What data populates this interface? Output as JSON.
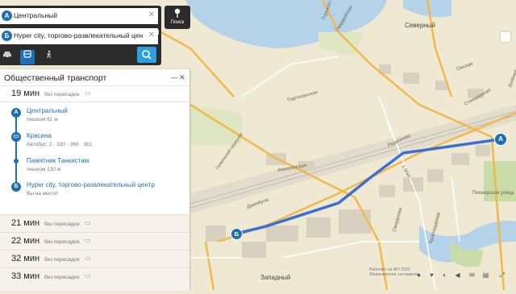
{
  "search": {
    "from_value": "Центральный",
    "to_value": "Hyper city, торгово-развлекательный центр",
    "from_marker": "А",
    "to_marker": "Б",
    "search_label": "Поиск",
    "modes": [
      "car-icon",
      "bus-icon",
      "walk-icon"
    ],
    "active_mode": "bus"
  },
  "transit": {
    "title": "Общественный транспорт",
    "best_route": {
      "time": "19 мин",
      "transfers": "без пересадок",
      "steps": [
        {
          "marker": "А",
          "name": "Центральный",
          "sub": "пешком 61 м"
        },
        {
          "name": "Красина",
          "sub": "Автобус: 2 · 330 · 360 · 361"
        },
        {
          "name": "Памятник Танкистам",
          "sub": "пешком 130 м"
        },
        {
          "marker": "Б",
          "name": "Hyper city, торгово-развлекательный центр",
          "sub": "Вы на месте!"
        }
      ]
    },
    "alternatives": [
      {
        "time": "21 мин",
        "transfers": "без пересадок"
      },
      {
        "time": "22 мин",
        "transfers": "без пересадок"
      },
      {
        "time": "32 мин",
        "transfers": "без пересадок"
      },
      {
        "time": "33 мин",
        "transfers": "без пересадок"
      }
    ]
  },
  "map_labels": {
    "severny": "Северный",
    "zapadny": "Западный",
    "partizanskaya": "Партизанская",
    "akmolinskaya": "Акмолинская",
    "dzhenbula": "Дженбула",
    "radionova": "Радионова",
    "stantsionnaya": "Станционная",
    "omskaya": "Омская",
    "gvardeyskaya": "Гвардейская",
    "gorkogo": "Горького",
    "pionerskaya": "Пионерская улица",
    "sverdlova": "Свердлова",
    "krasnodarova": "Краснодарова",
    "galkinskii": "Галкинский переулок",
    "mai1": "1 Мая",
    "zyolenyi": "Зелёная"
  },
  "attribution": {
    "line1": "Работает на API 2GIS",
    "line2": "Лицензионное соглашение"
  },
  "toolbar": [
    "person-icon",
    "heart-icon",
    "comment-icon",
    "share-icon",
    "mail-icon",
    "print-icon",
    "fullscreen-icon"
  ],
  "colors": {
    "route": "#3b6fd4",
    "accent": "#1d6fb8",
    "water": "#b5d3e8",
    "park": "#c9dba7",
    "road_major": "#f1b84a"
  }
}
